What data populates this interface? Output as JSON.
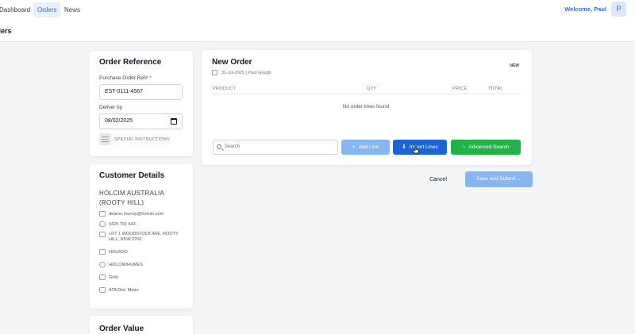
{
  "nav": {
    "items": [
      {
        "label": "Dashboard",
        "active": false
      },
      {
        "label": "Orders",
        "active": true
      },
      {
        "label": "News",
        "active": false
      }
    ],
    "welcome": "Welcome, Paul",
    "avatar_initial": "P"
  },
  "page": {
    "title": "rders"
  },
  "order_reference": {
    "title": "Order Reference",
    "po_label": "Purchase Order Ref#",
    "po_required_mark": "*",
    "po_value": "EST-0111-4567",
    "deliver_label": "Deliver by",
    "deliver_value": "08/02/2025",
    "special_instructions": "SPECIAL INSTRUCTIONS"
  },
  "customer": {
    "title": "Customer Details",
    "name": "HOLCIM AUSTRALIA (ROOTY HILL)",
    "email": "dearne.murray@holcim.com",
    "phone": "0429 791 643",
    "address": "LOT 1 WOODSTOCK AVE, ROOTY HILL, NSW 2766",
    "code": "HOLROO",
    "group": "HOLCIM/HUMES",
    "tier": "Gold",
    "district": "ATA Dist. Metro"
  },
  "order_value": {
    "title": "Order Value"
  },
  "new_order": {
    "title": "New Order",
    "date": "31-Jul-2025",
    "author": "Paul Gough",
    "badge": "NEW",
    "columns": [
      "PRODUCT",
      "QTY",
      "PRICE",
      "TOTAL"
    ],
    "empty_message": "No order lines found",
    "search_placeholder": "Search",
    "add_line": "Add Line",
    "import_lines": "Import Lines",
    "advanced_search": "Advanced Search"
  },
  "actions": {
    "cancel": "Cancel",
    "save_submit": "Save and Submit"
  },
  "colors": {
    "primary": "#1a63d8",
    "primary_light": "#86b5f0",
    "success": "#21b24a",
    "nav_active_bg": "#e8f0fc"
  }
}
